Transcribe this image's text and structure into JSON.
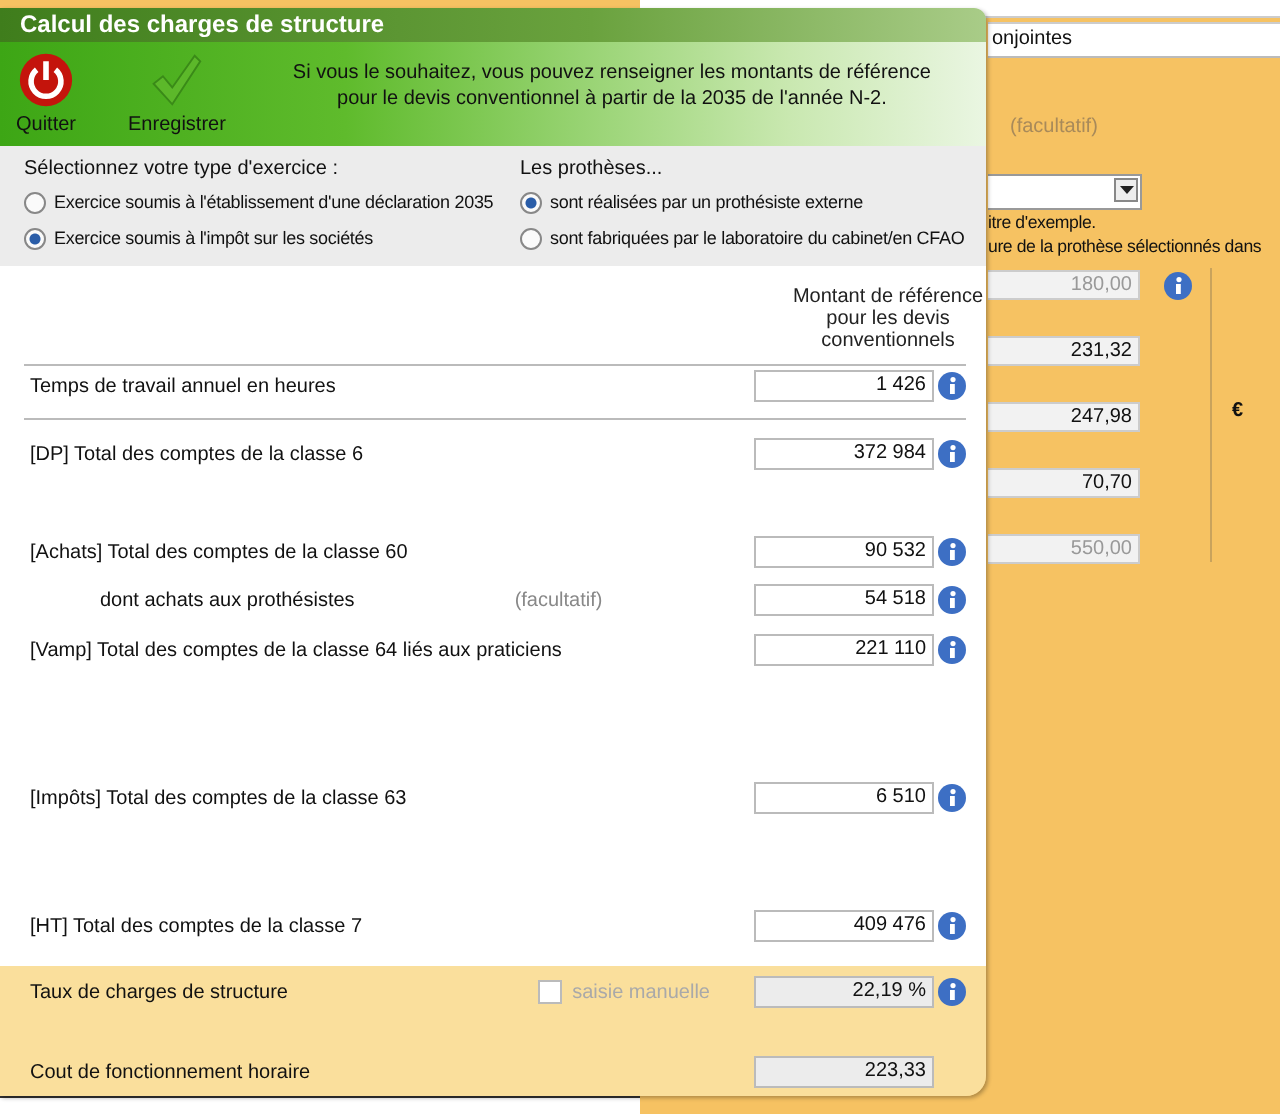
{
  "background": {
    "field": "onjointes",
    "note": "(facultatif)",
    "hints": [
      "itre d'exemple.",
      "ure de la prothèse sélectionnés dans"
    ],
    "fields": [
      {
        "value": "180,00",
        "disabled": true,
        "info": true
      },
      {
        "value": "231,32",
        "disabled": false,
        "info": false
      },
      {
        "value": "247,98",
        "disabled": false,
        "info": false
      },
      {
        "value": "70,70",
        "disabled": false,
        "info": false
      },
      {
        "value": "550,00",
        "disabled": true,
        "info": false
      }
    ],
    "currency": "€"
  },
  "window": {
    "title": "Calcul des charges de structure"
  },
  "toolbar": {
    "buttons": [
      {
        "label": "Quitter",
        "kind": "power"
      },
      {
        "label": "Enregistrer",
        "kind": "check"
      }
    ],
    "message": "Si vous le souhaitez, vous pouvez renseigner les montants de référence pour le devis conventionnel à partir de la 2035 de l'année N-2."
  },
  "groups": [
    {
      "title": "Sélectionnez votre type d'exercice :",
      "options": [
        {
          "label": "Exercice soumis à l'établissement d'une déclaration 2035",
          "selected": false
        },
        {
          "label": "Exercice soumis à l'impôt sur les sociétés",
          "selected": true
        }
      ]
    },
    {
      "title": "Les prothèses...",
      "options": [
        {
          "label": "sont réalisées par un prothésiste externe",
          "selected": true
        },
        {
          "label": "sont fabriquées par le laboratoire du cabinet/en CFAO",
          "selected": false
        }
      ]
    }
  ],
  "amount_header": "Montant de référence pour les devis conventionnels",
  "rows": [
    {
      "label": "Temps de travail annuel en heures",
      "value": "1 426",
      "kind": "main",
      "info": true
    },
    {
      "label": "[DP] Total des comptes de la classe 6",
      "value": "372 984",
      "kind": "main",
      "info": true
    },
    {
      "label": "[Achats] Total des comptes de la classe 60",
      "value": "90 532",
      "kind": "main",
      "info": true
    },
    {
      "label": "dont achats aux prothésistes",
      "note": "(facultatif)",
      "value": "54 518",
      "kind": "sub",
      "info": true
    },
    {
      "label": "[Vamp] Total des comptes de la classe 64 liés aux praticiens",
      "value": "221 110",
      "kind": "main",
      "info": true
    },
    {
      "label": "[Impôts] Total des comptes de la classe 63",
      "value": "6 510",
      "kind": "main",
      "info": true
    },
    {
      "label": "[HT] Total des comptes de la classe 7",
      "value": "409 476",
      "kind": "main",
      "info": true
    }
  ],
  "summary": [
    {
      "label": "Taux de charges de structure",
      "value": "22,19 %",
      "readonly": true,
      "info": true,
      "manual": {
        "label": "saisie manuelle",
        "checked": false,
        "disabled": true
      }
    },
    {
      "label": "Cout de fonctionnement horaire",
      "value": "223,33",
      "readonly": true,
      "info": false
    }
  ]
}
